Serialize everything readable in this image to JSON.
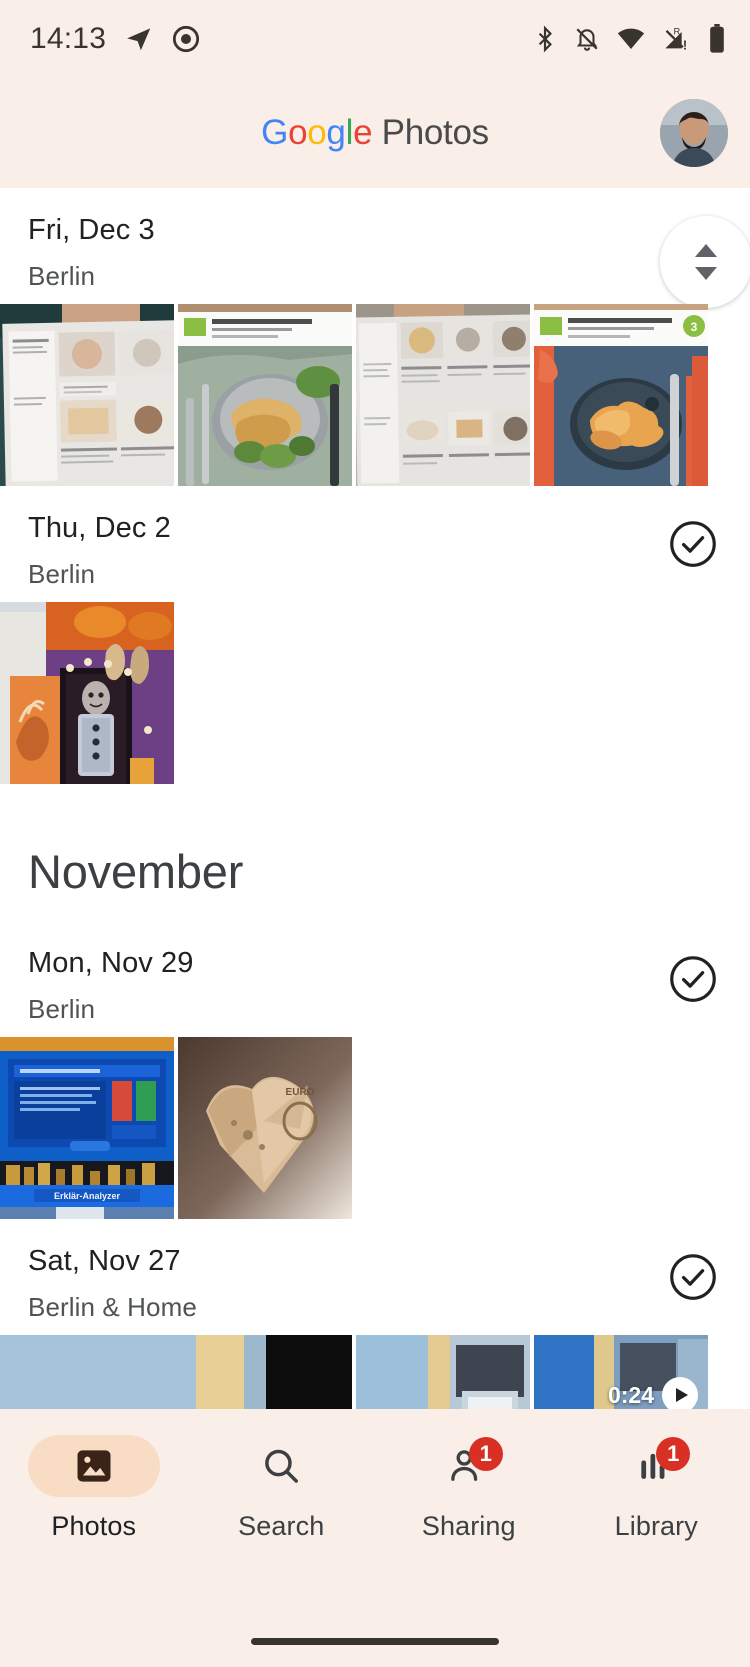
{
  "status_bar": {
    "time": "14:13",
    "left_icons": [
      "telegram-icon",
      "record-target-icon"
    ],
    "right_icons": [
      "bluetooth-icon",
      "notifications-off-icon",
      "wifi-icon",
      "cellular-roaming-warning-icon",
      "battery-icon"
    ],
    "background": "#faeee8"
  },
  "app_bar": {
    "brand_google": "Google",
    "brand_product": "Photos",
    "avatar_label": "account-avatar",
    "colors": {
      "blue": "#4285F4",
      "red": "#EA4335",
      "yellow": "#FBBC05",
      "green": "#34A853",
      "product_gray": "#4a4a4a"
    }
  },
  "scroll_thumb": {
    "up_label": "scroll-up",
    "down_label": "scroll-down"
  },
  "sections": [
    {
      "type": "day",
      "title": "Fri, Dec 3",
      "place": "Berlin",
      "select_all": "select-all-checkmark",
      "photos": [
        {
          "name": "recipe-card-spread",
          "alt": "HelloFresh recipe booklet spread on table"
        },
        {
          "name": "chicken-dish-plate",
          "alt": "Plate with breaded chicken and broccoli"
        },
        {
          "name": "recipe-card-steps",
          "alt": "Recipe card with cooking steps"
        },
        {
          "name": "salmon-dish-plate",
          "alt": "Plate of fish and vegetables on dark plate"
        }
      ]
    },
    {
      "type": "day",
      "title": "Thu, Dec 2",
      "place": "Berlin",
      "select_all": "select-all-checkmark",
      "photos": [
        {
          "name": "advent-calendar-figure",
          "alt": "Purple advent calendar with figurine"
        }
      ]
    },
    {
      "type": "month",
      "title": "November"
    },
    {
      "type": "day",
      "title": "Mon, Nov 29",
      "place": "Berlin",
      "select_all": "select-all-checkmark",
      "photos": [
        {
          "name": "blue-info-display",
          "alt": "Blue illuminated museum display screen"
        },
        {
          "name": "origami-heart",
          "alt": "Folded paper heart made from a euro note"
        }
      ]
    },
    {
      "type": "day",
      "title": "Sat, Nov 27",
      "place": "Berlin & Home",
      "select_all": "select-all-checkmark",
      "photos": [
        {
          "name": "room-with-monitor",
          "alt": "Light blue room with black monitor"
        },
        {
          "name": "person-in-room",
          "alt": "Person seated in blue room"
        },
        {
          "name": "video-clip",
          "alt": "Video clip in blue room",
          "video": true,
          "duration": "0:24"
        }
      ]
    }
  ],
  "bottom_nav": {
    "items": [
      {
        "label": "Photos",
        "icon": "photos-icon",
        "active": true,
        "badge": null
      },
      {
        "label": "Search",
        "icon": "search-icon",
        "active": false,
        "badge": null
      },
      {
        "label": "Sharing",
        "icon": "sharing-icon",
        "active": false,
        "badge": "1"
      },
      {
        "label": "Library",
        "icon": "library-icon",
        "active": false,
        "badge": "1"
      }
    ],
    "active_pill_color": "#f9dcc4",
    "badge_color": "#d93025",
    "background": "#faeee8"
  }
}
